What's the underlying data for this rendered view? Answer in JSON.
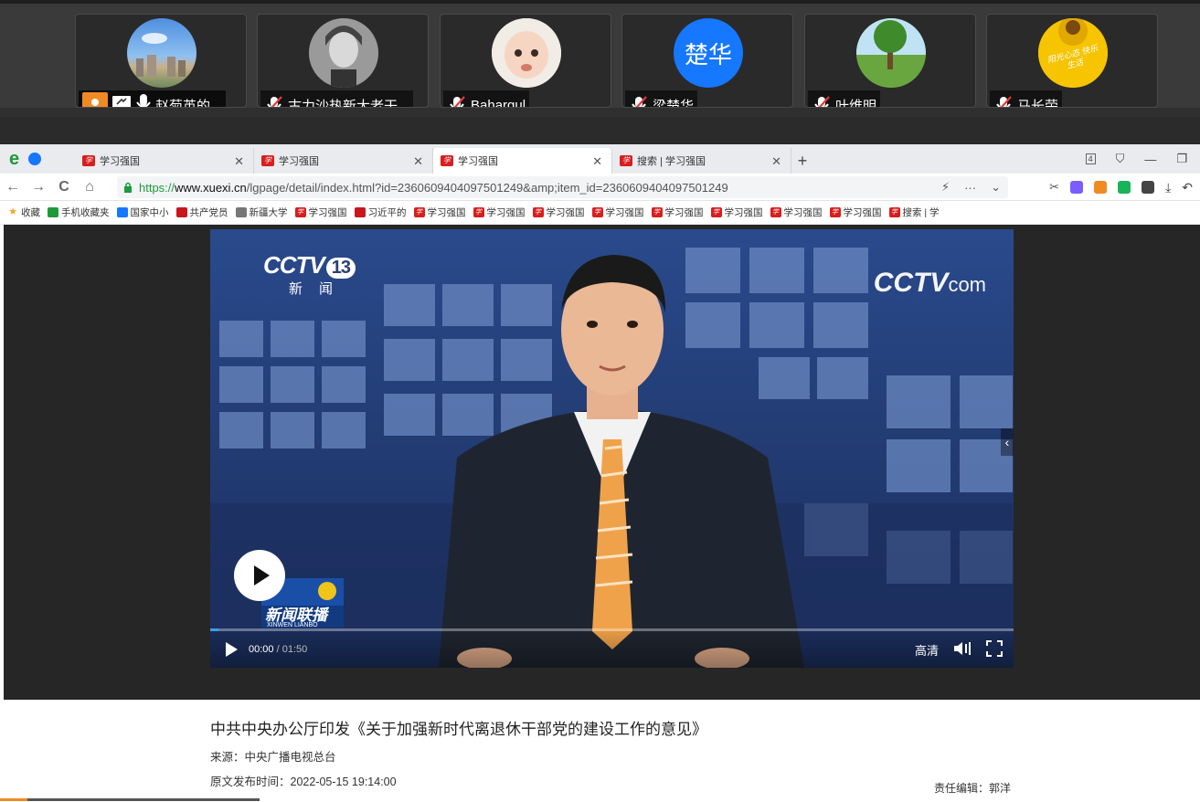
{
  "meeting": {
    "participants": [
      {
        "name": "赵菊英的...",
        "avatar": "sky-city-photo",
        "muted": false,
        "host": true,
        "sharing": true
      },
      {
        "name": "古力沙热新大老干...",
        "avatar": "child-portrait-photo",
        "muted": true
      },
      {
        "name": "Bahargul",
        "avatar": "baby-photo",
        "muted": true
      },
      {
        "name": "梁楚华",
        "avatar_text": "楚华",
        "avatar_color": "#1677ff",
        "muted": true
      },
      {
        "name": "叶维明",
        "avatar": "green-landscape-photo",
        "muted": true
      },
      {
        "name": "马长荣",
        "avatar": "sunflower-photo",
        "avatar_text": "阳光心态 快乐生活",
        "muted": true
      }
    ]
  },
  "browser": {
    "tabs": [
      {
        "label": "学习强国",
        "active": false
      },
      {
        "label": "学习强国",
        "active": false
      },
      {
        "label": "学习强国",
        "active": true
      },
      {
        "label": "搜索 | 学习强国",
        "active": false
      }
    ],
    "tab_count_badge": "4",
    "url": {
      "protocol": "https://",
      "host": "www.xuexi.cn",
      "path": "/lgpage/detail/index.html?id=2360609404097501249&amp;item_id=2360609404097501249"
    },
    "bookmarks": [
      {
        "label": "收藏",
        "icon": "star-icon",
        "color": "#f5a623"
      },
      {
        "label": "手机收藏夹",
        "icon": "phone-icon",
        "color": "#1e9a3c"
      },
      {
        "label": "国家中小",
        "icon": "globe-icon",
        "color": "#1677ff"
      },
      {
        "label": "共产党员",
        "icon": "party-icon",
        "color": "#c8161d"
      },
      {
        "label": "新疆大学",
        "icon": "globe-icon",
        "color": "#777777"
      },
      {
        "label": "学习强国",
        "icon": "xuexi-icon",
        "color": "#d81e1e"
      },
      {
        "label": "习近平的",
        "icon": "party-icon",
        "color": "#c8161d"
      },
      {
        "label": "学习强国",
        "icon": "xuexi-icon",
        "color": "#d81e1e"
      },
      {
        "label": "学习强国",
        "icon": "xuexi-icon",
        "color": "#d81e1e"
      },
      {
        "label": "学习强国",
        "icon": "xuexi-icon",
        "color": "#d81e1e"
      },
      {
        "label": "学习强国",
        "icon": "xuexi-icon",
        "color": "#d81e1e"
      },
      {
        "label": "学习强国",
        "icon": "xuexi-icon",
        "color": "#d81e1e"
      },
      {
        "label": "学习强国",
        "icon": "xuexi-icon",
        "color": "#d81e1e"
      },
      {
        "label": "学习强国",
        "icon": "xuexi-icon",
        "color": "#d81e1e"
      },
      {
        "label": "学习强国",
        "icon": "xuexi-icon",
        "color": "#d81e1e"
      },
      {
        "label": "搜索 | 学",
        "icon": "xuexi-icon",
        "color": "#d81e1e"
      }
    ]
  },
  "video": {
    "channel_logo": "CCTV",
    "channel_number": "13",
    "channel_sub": "新闻",
    "site_logo": "CCTV",
    "site_logo_suffix": "com",
    "program_logo": "新闻联播",
    "program_logo_sub": "XINWEN LIANBO",
    "current_time": "00:00",
    "separator": "/",
    "duration": "01:50",
    "progress": 0.01,
    "quality_label": "高清"
  },
  "article": {
    "title": "中共中央办公厅印发《关于加强新时代离退休干部党的建设工作的意见》",
    "source": "来源：中央广播电视总台",
    "publish_time": "原文发布时间：2022-05-15 19:14:00",
    "editor": "责任编辑：郭洋"
  }
}
